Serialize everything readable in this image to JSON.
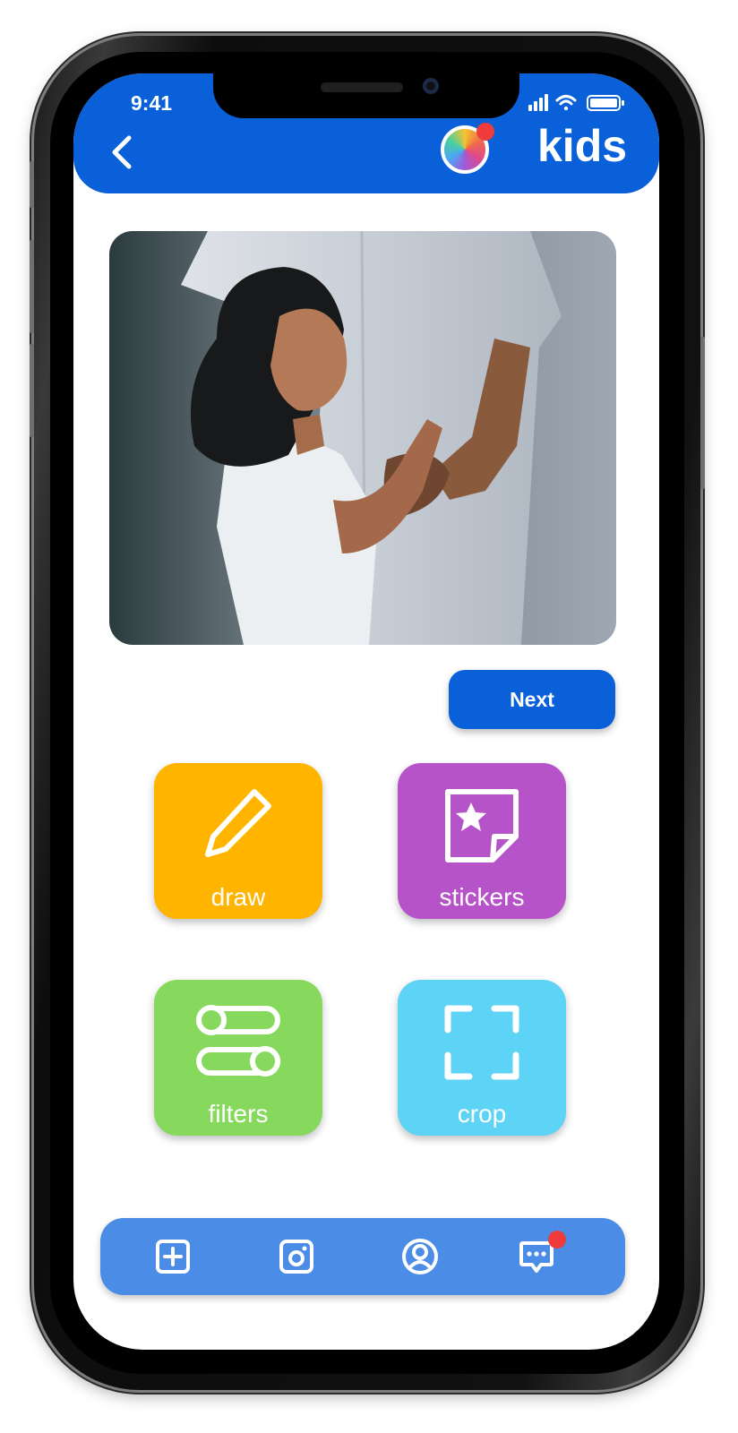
{
  "status_bar": {
    "time": "9:41"
  },
  "header": {
    "brand": "kids",
    "back_icon": "chevron-left-icon",
    "avatar_icon": "color-wheel-avatar"
  },
  "photo": {
    "description_icon": "photo-of-child"
  },
  "next_button": {
    "label": "Next"
  },
  "tools": [
    {
      "label": "draw",
      "icon": "pencil-icon",
      "color": "#FFB400"
    },
    {
      "label": "stickers",
      "icon": "sticker-icon",
      "color": "#B653C9"
    },
    {
      "label": "filters",
      "icon": "sliders-icon",
      "color": "#86D95C"
    },
    {
      "label": "crop",
      "icon": "crop-icon",
      "color": "#5DD3F5"
    }
  ],
  "bottom_nav": [
    {
      "icon": "add-square-icon"
    },
    {
      "icon": "camera-icon"
    },
    {
      "icon": "profile-icon"
    },
    {
      "icon": "chat-icon"
    }
  ],
  "colors": {
    "primary": "#0A60D8",
    "nav": "#4B8DE6",
    "notification": "#EE3C3C"
  }
}
